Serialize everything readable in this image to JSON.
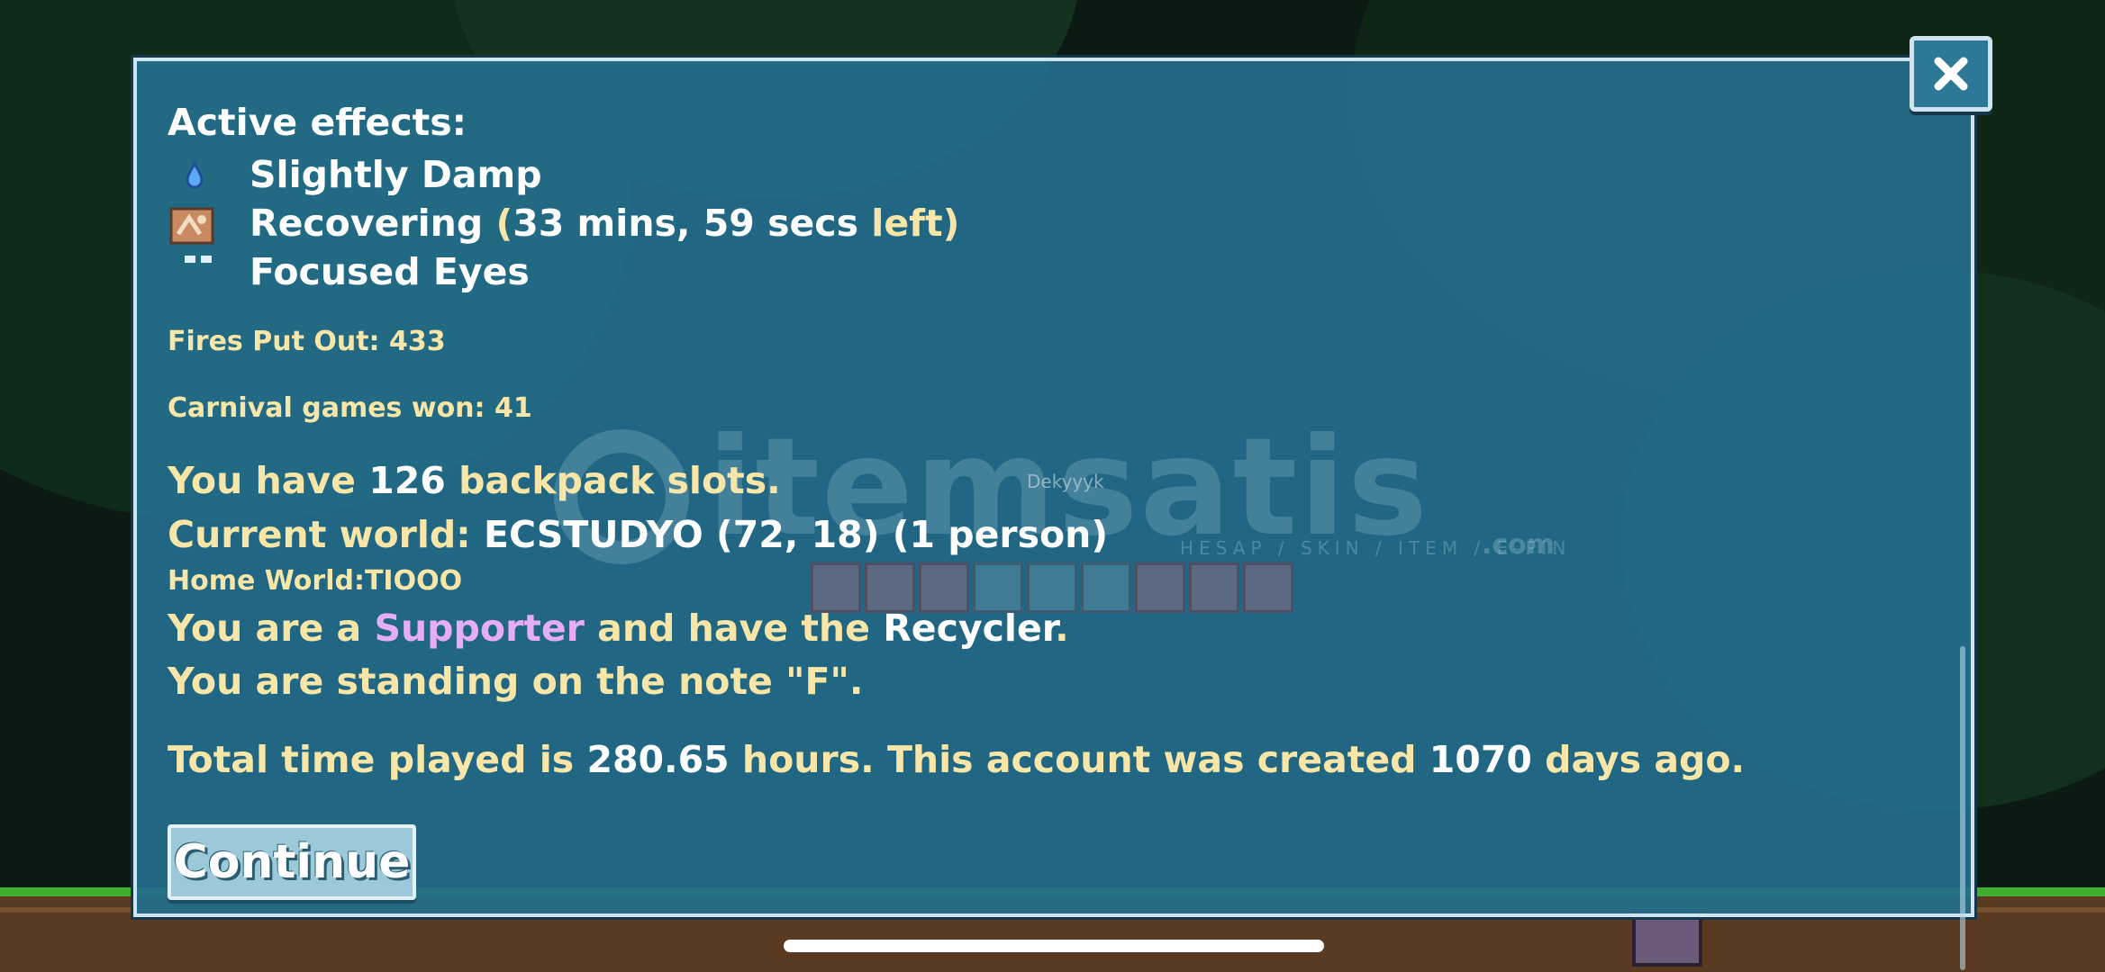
{
  "effects_title": "Active effects:",
  "effects": [
    {
      "icon": "water-drop-icon",
      "label": "Slightly Damp",
      "suffix_open": "",
      "time": "",
      "suffix_left": "",
      "suffix_close": ""
    },
    {
      "icon": "recovering-bandage-icon",
      "label": "Recovering ",
      "suffix_open": "(",
      "time": "33 mins, 59 secs",
      "suffix_left": " left",
      "suffix_close": ")"
    },
    {
      "icon": "eyes-icon",
      "label": "Focused Eyes",
      "suffix_open": "",
      "time": "",
      "suffix_left": "",
      "suffix_close": ""
    }
  ],
  "stats": {
    "fires": "Fires Put Out: 433",
    "carnival": "Carnival games won: 41"
  },
  "info": {
    "backpack_pre": "You have ",
    "backpack_num": "126",
    "backpack_post": " backpack slots.",
    "world_pre": "Current world: ",
    "world_val": "ECSTUDYO (72, 18) (1 person)",
    "home": "Home World:TIOOO",
    "supporter_pre": "You are a ",
    "supporter_word": "Supporter",
    "supporter_mid": " and have the ",
    "recycler_word": "Recycler",
    "supporter_end": ".",
    "note": "You are standing on the note \"F\".",
    "time_pre": "Total time played is ",
    "time_val": "280.65",
    "time_mid": " hours.  This account was created ",
    "days_val": "1070",
    "time_post": " days ago."
  },
  "buttons": {
    "continue": "Continue",
    "close_icon": "close-icon"
  },
  "background": {
    "watermark": "itemsatis",
    "watermark_sub": "HESAP / SKIN / ITEM / E-PIN",
    "watermark_com": ".com",
    "player_name": "Dekyyyk"
  }
}
